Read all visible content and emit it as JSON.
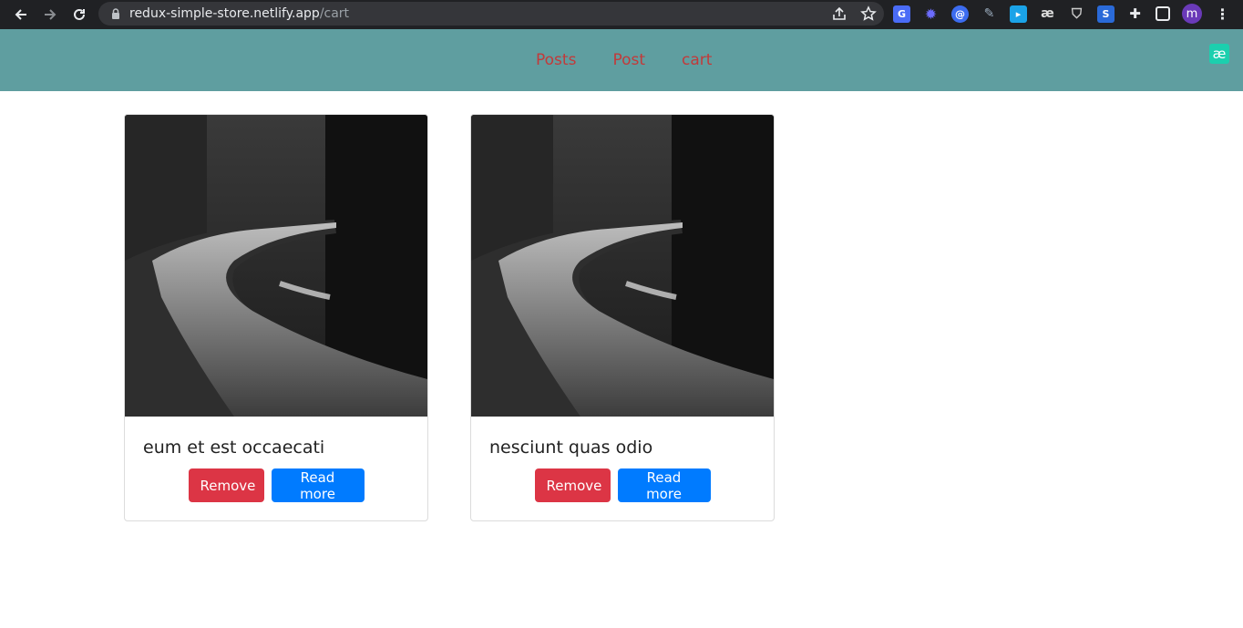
{
  "browser": {
    "url_host": "redux-simple-store.netlify.app",
    "url_path": "/cart",
    "profile_initial": "m"
  },
  "navbar": {
    "background": "#5f9ea0",
    "link_color": "#c23a3a",
    "links": [
      "Posts",
      "Post",
      "cart"
    ],
    "badge": "æ"
  },
  "cards": [
    {
      "title": "eum et est occaecati",
      "remove_label": "Remove",
      "read_label": "Read more"
    },
    {
      "title": "nesciunt quas odio",
      "remove_label": "Remove",
      "read_label": "Read more"
    }
  ],
  "colors": {
    "remove": "#dc3545",
    "read_more": "#007bff"
  }
}
